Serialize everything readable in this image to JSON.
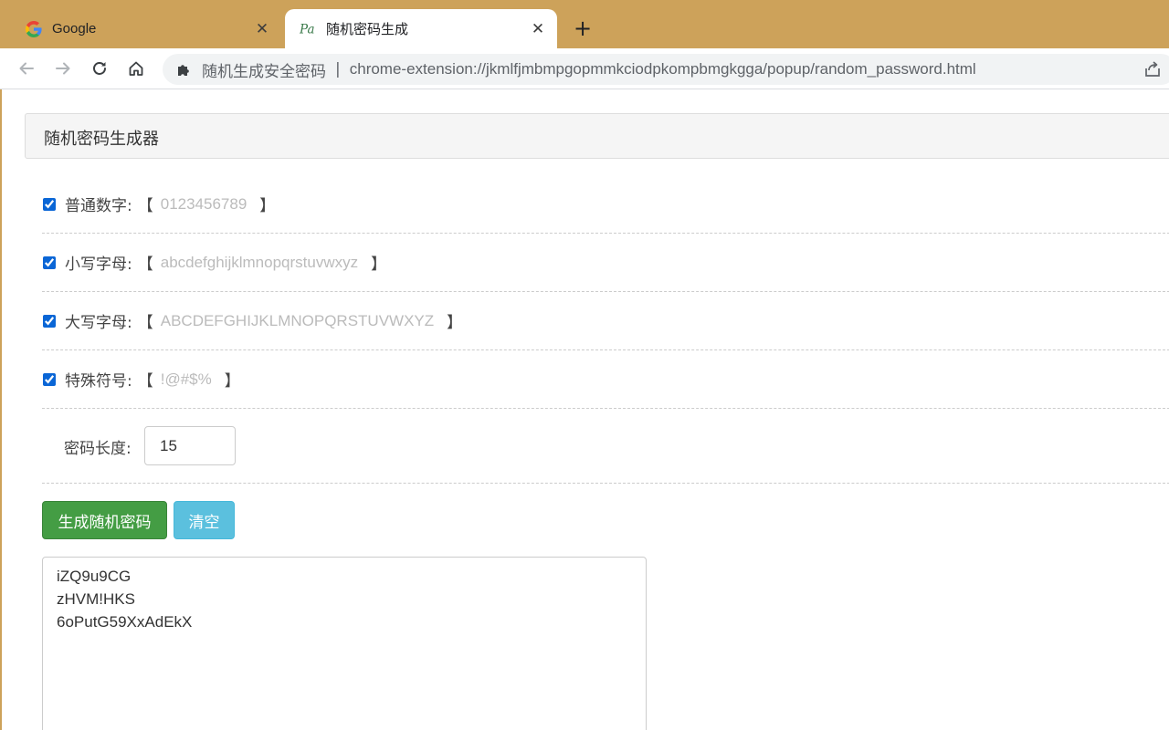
{
  "browser": {
    "tabs": [
      {
        "title": "Google",
        "favicon": "google-g-icon",
        "active": false
      },
      {
        "title": "随机密码生成",
        "favicon": "pa-icon",
        "active": true
      }
    ],
    "new_tab_label": "+",
    "close_glyph": "✕",
    "omnibox": {
      "site_name": "随机生成安全密码",
      "separator": "|",
      "url": "chrome-extension://jkmlfjmbmpgopmmkciodpkompbmgkgga/popup/random_password.html"
    },
    "colors": {
      "tabstrip": "#cda25a",
      "accent_checkbox": "#0a66d6"
    }
  },
  "page": {
    "title": "随机密码生成器",
    "options": [
      {
        "label": "普通数字:",
        "bracket_open": "【",
        "chars": "0123456789",
        "bracket_close": "】",
        "checked": true
      },
      {
        "label": "小写字母:",
        "bracket_open": "【",
        "chars": "abcdefghijklmnopqrstuvwxyz",
        "bracket_close": "】",
        "checked": true
      },
      {
        "label": "大写字母:",
        "bracket_open": "【",
        "chars": "ABCDEFGHIJKLMNOPQRSTUVWXYZ",
        "bracket_close": "】",
        "checked": true
      },
      {
        "label": "特殊符号:",
        "bracket_open": "【",
        "chars": "!@#$%",
        "bracket_close": "】",
        "checked": true
      }
    ],
    "length_label": "密码长度:",
    "length_value": "15",
    "generate_button": "生成随机密码",
    "clear_button": "清空",
    "output_lines": [
      "iZQ9u9CG",
      "zHVM!HKS",
      "6oPutG59XxAdEkX"
    ],
    "colors": {
      "generate": "#449d44",
      "clear": "#5bc0de"
    }
  }
}
